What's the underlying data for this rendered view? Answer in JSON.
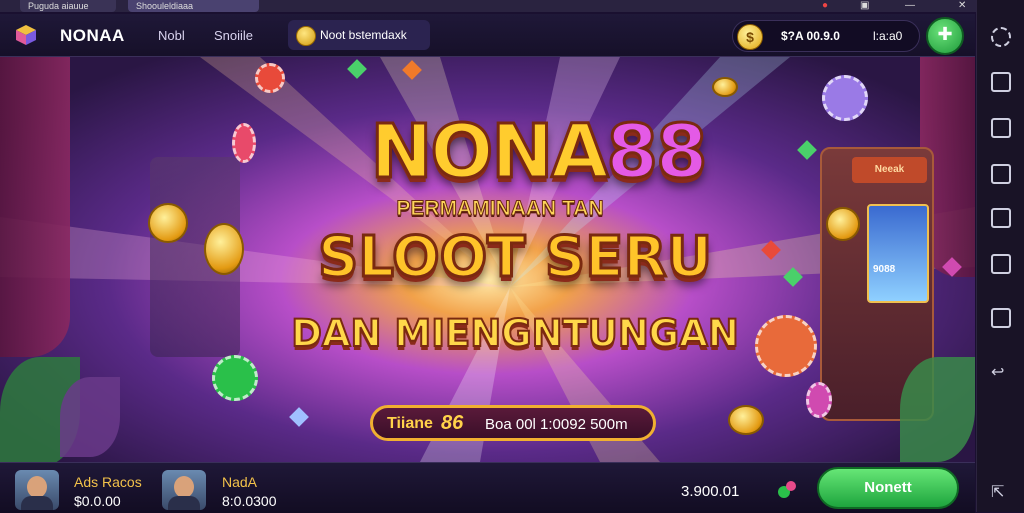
{
  "window": {
    "tabs": [
      "Puguda aiauue",
      "Shoouleldiaaa"
    ]
  },
  "header": {
    "brand": "NONAA",
    "nav": [
      "Nobl",
      "Snoiile"
    ],
    "active_tab": "Noot bstemdaxk",
    "balance": "$?A 00.9.0",
    "balance_extra": "l:a:a0",
    "colors": {
      "accent_green": "#1ea53e",
      "gold": "#f0b030"
    }
  },
  "banner": {
    "title_part1": "NONA",
    "title_part2": "88",
    "subtitle": "PERMAMINAAN TAN",
    "line2": "SLOOT SERU",
    "line3": "DAN MIENGNTUNGAN",
    "pill_label": "Tiiane",
    "pill_number": "86",
    "pill_text": "Boa 00l 1:0092 500m",
    "arcade_sign": "Neeak",
    "arcade_screen": "9088"
  },
  "footer": {
    "players": [
      {
        "name": "Ads Racos",
        "value": "$0.0.00"
      },
      {
        "name": "NadA",
        "value": "8:0.0300"
      }
    ],
    "amount": "3.900.01",
    "button_label": "Nonett"
  },
  "sidebar": {
    "icons": [
      "expand-icon",
      "screen-rotate-icon",
      "screenshot-icon",
      "record-icon",
      "multi-window-icon",
      "fullscreen-icon",
      "import-icon",
      "back-icon",
      "settings-icon"
    ]
  }
}
